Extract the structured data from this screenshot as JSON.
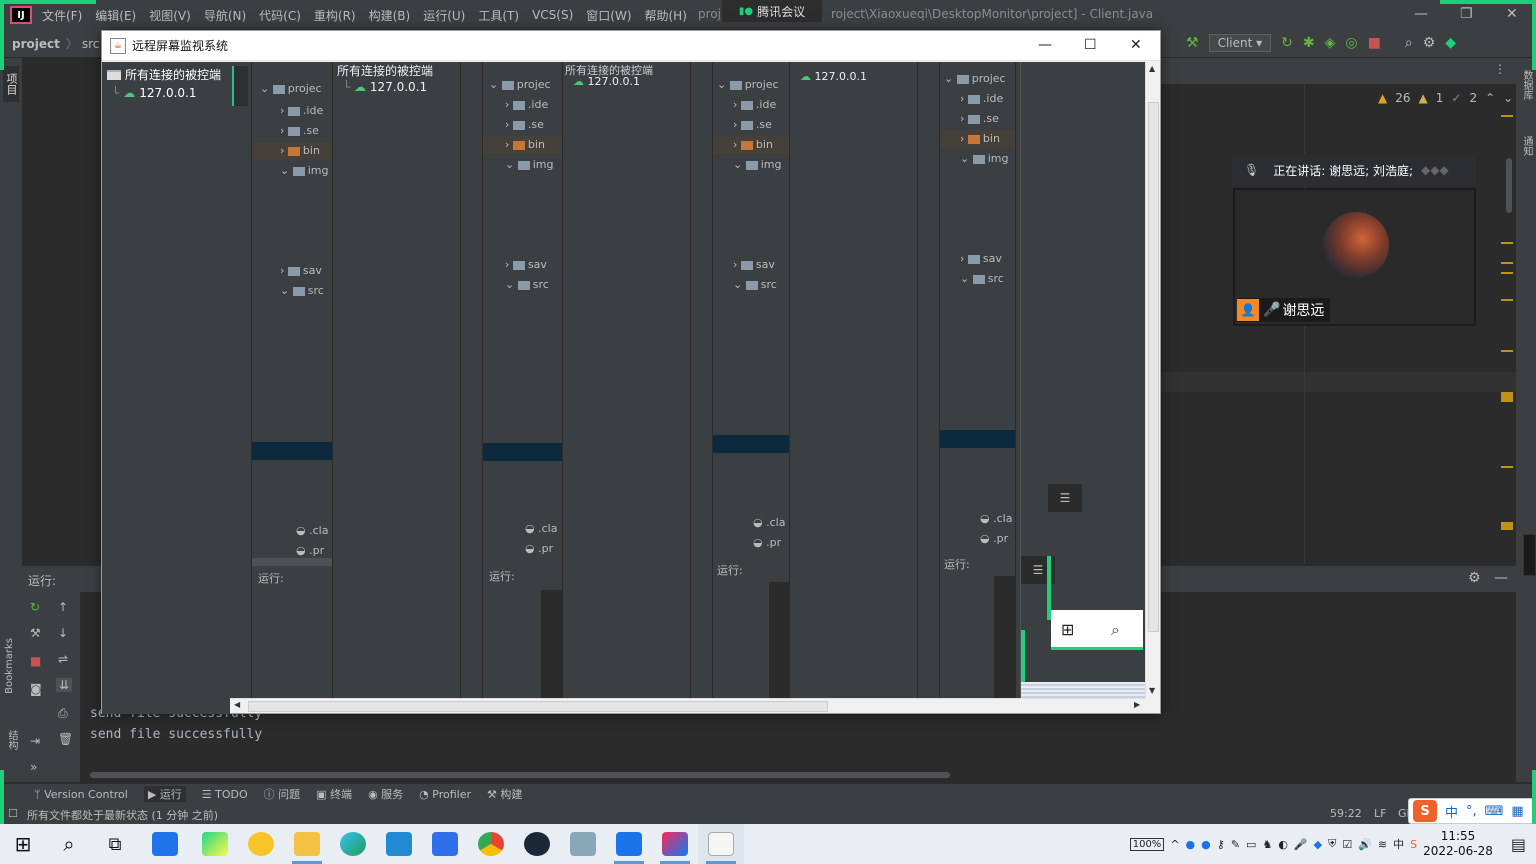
{
  "ide": {
    "menu": [
      "文件(F)",
      "编辑(E)",
      "视图(V)",
      "导航(N)",
      "代码(C)",
      "重构(R)",
      "构建(B)",
      "运行(U)",
      "工具(T)",
      "VCS(S)",
      "窗口(W)",
      "帮助(H)"
    ],
    "title_fragment": "proj",
    "title_path": "roject\\Xiaoxueqi\\DesktopMonitor\\project] - Client.java",
    "breadcrumb": [
      "project",
      "src"
    ],
    "run_config": "Client",
    "inspections": {
      "warnings": "26",
      "weak_warnings": "1",
      "typos": "2"
    },
    "project_tab": "项目",
    "run_label": "运行:",
    "console": [
      "send file successfully",
      "send file successfully"
    ],
    "tool_tabs": [
      "Version Control",
      "运行",
      "TODO",
      "问题",
      "终端",
      "服务",
      "Profiler",
      "构建"
    ],
    "status_text": "所有文件都处于最新状态 (1 分钟 之前)",
    "cursor_pos": "59:22",
    "line_sep": "LF",
    "encoding_fragment": "GI",
    "bookmarks_label": "Bookmarks",
    "structure_label": "结构",
    "right_stripe": [
      "数据库",
      "通知"
    ]
  },
  "meeting": {
    "pill_label": "腾讯会议",
    "speaking": "正在讲话: 谢思远; 刘浩庭;",
    "participant_name": "谢思远"
  },
  "monitor": {
    "title": "远程屏幕监视系统",
    "tree_root": "所有连接的被控端",
    "tree_child": "127.0.0.1",
    "echo_project": "projec",
    "echo_items": [
      ".ide",
      ".se",
      "bin",
      "img",
      "sav",
      "src"
    ],
    "echo_files": [
      ".cla",
      ".pr"
    ]
  },
  "taskbar": {
    "battery": "100%",
    "ime": "中",
    "time": "11:55",
    "date": "2022-06-28",
    "apps": [
      "start-icon",
      "search-icon",
      "task-view-icon",
      "todo-icon",
      "pycharm-icon",
      "kugou-icon",
      "file-explorer-icon",
      "edge-icon",
      "vscode-icon",
      "wps-writer-icon",
      "chrome-icon",
      "steam-icon",
      "game-icon",
      "tencent-meeting-icon",
      "intellij-icon",
      "java-icon"
    ]
  },
  "colors": {
    "accent_green": "#1fd07a",
    "ide_bg": "#2b2b2b",
    "ide_panel": "#3c3f41",
    "selection": "#0d293e"
  }
}
